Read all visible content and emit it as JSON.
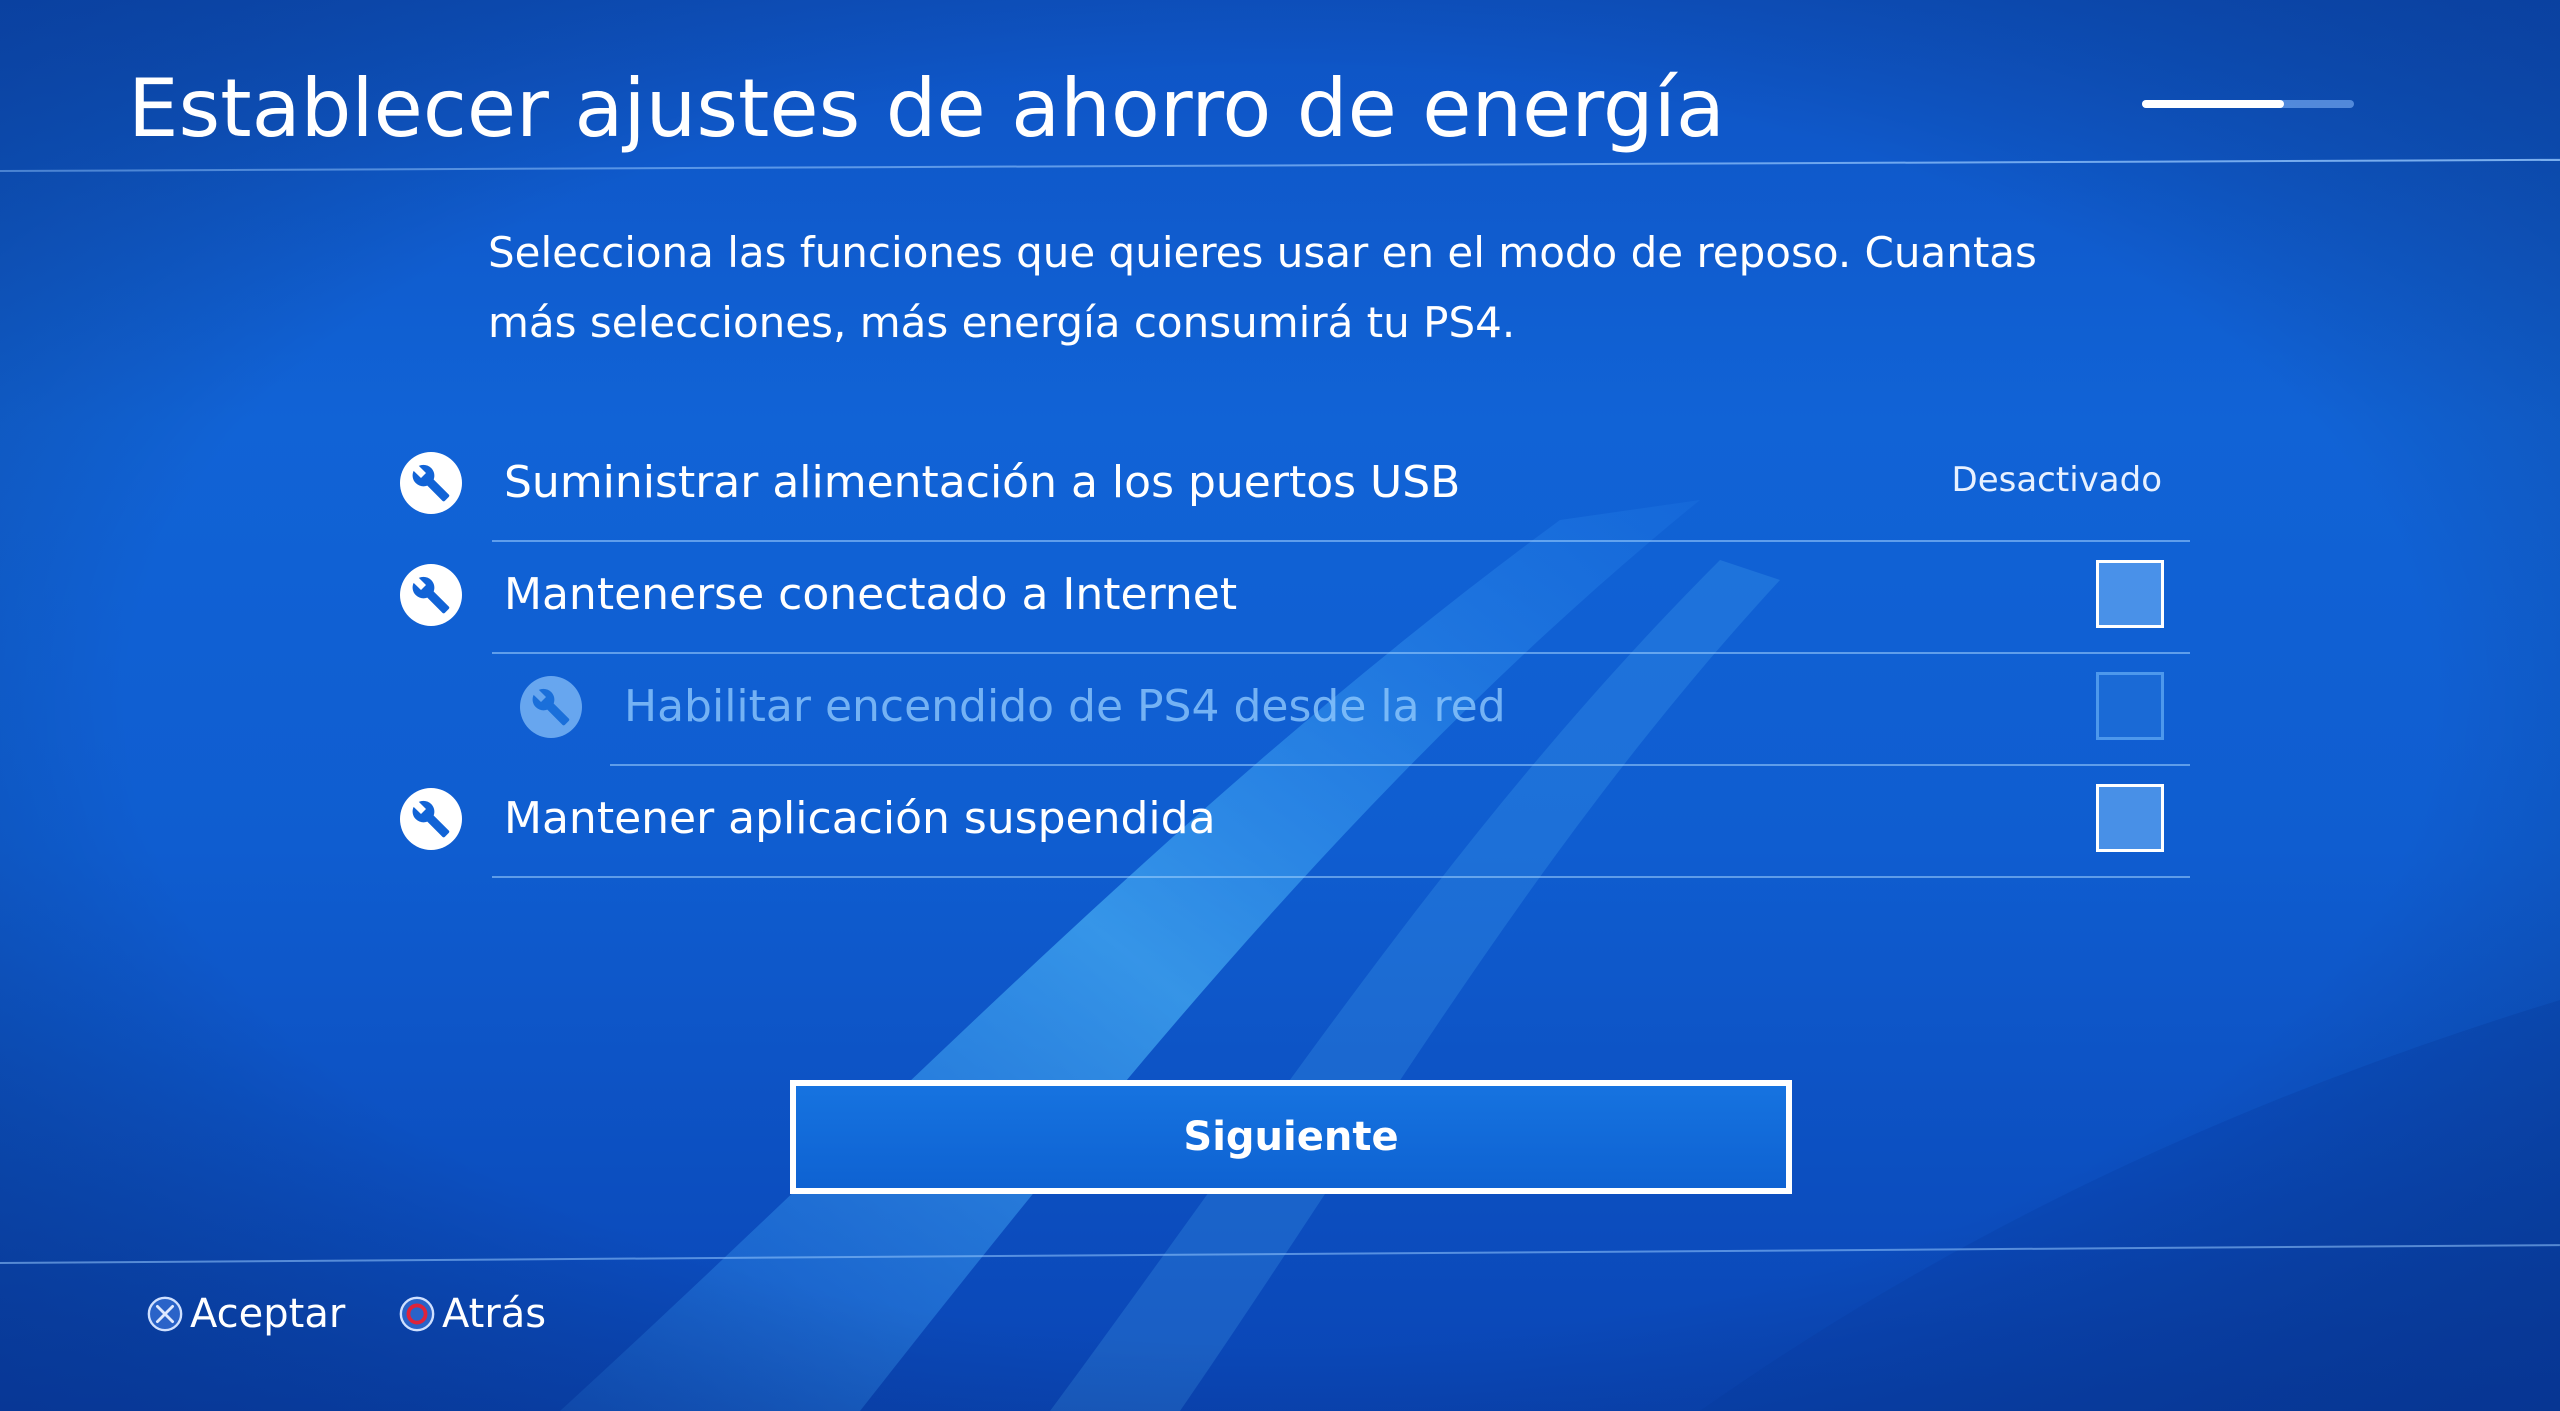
{
  "header": {
    "title": "Establecer ajustes de ahorro de energía",
    "progress_fraction": 0.67
  },
  "description": "Selecciona las funciones que quieres usar en el modo de reposo. Cuantas más selecciones, más energía consumirá tu PS4.",
  "settings": {
    "items": [
      {
        "label": "Suministrar alimentación a los puertos USB",
        "value": "Desactivado",
        "control": "value",
        "icon": "wrench-icon",
        "enabled": true
      },
      {
        "label": "Mantenerse conectado a Internet",
        "control": "checkbox",
        "checked": false,
        "icon": "wrench-icon",
        "enabled": true
      },
      {
        "label": "Habilitar encendido de PS4 desde la red",
        "control": "checkbox",
        "checked": false,
        "icon": "wrench-icon",
        "enabled": false
      },
      {
        "label": "Mantener aplicación suspendida",
        "control": "checkbox",
        "checked": false,
        "icon": "wrench-icon",
        "enabled": true
      }
    ]
  },
  "actions": {
    "next_label": "Siguiente"
  },
  "footer": {
    "accept_label": "Aceptar",
    "accept_icon": "cross-button-icon",
    "back_label": "Atrás",
    "back_icon": "circle-button-icon"
  },
  "colors": {
    "background": "#1163d6",
    "circle_button": "#e0233a",
    "disabled_text": "#96cdff"
  }
}
